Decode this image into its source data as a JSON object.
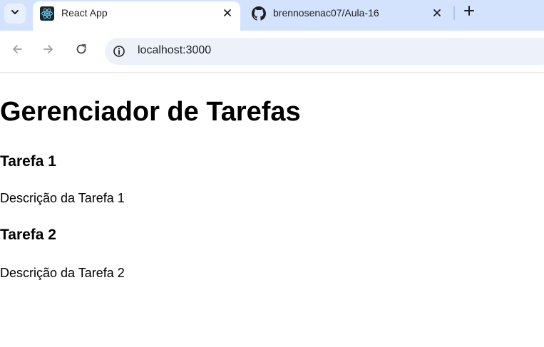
{
  "browser": {
    "tabs": [
      {
        "title": "React App",
        "favicon": "react-logo-icon",
        "active": true
      },
      {
        "title": "brennosenac07/Aula-16",
        "favicon": "github-logo-icon",
        "active": false
      }
    ],
    "address_bar": {
      "url": "localhost:3000"
    }
  },
  "page": {
    "title": "Gerenciador de Tarefas",
    "tasks": [
      {
        "name": "Tarefa 1",
        "description": "Descrição da Tarefa 1"
      },
      {
        "name": "Tarefa 2",
        "description": "Descrição da Tarefa 2"
      }
    ]
  },
  "colors": {
    "tabstrip_bg": "#d3e3fd",
    "omnibox_bg": "#edf2fa",
    "react_accent": "#61dafb"
  }
}
